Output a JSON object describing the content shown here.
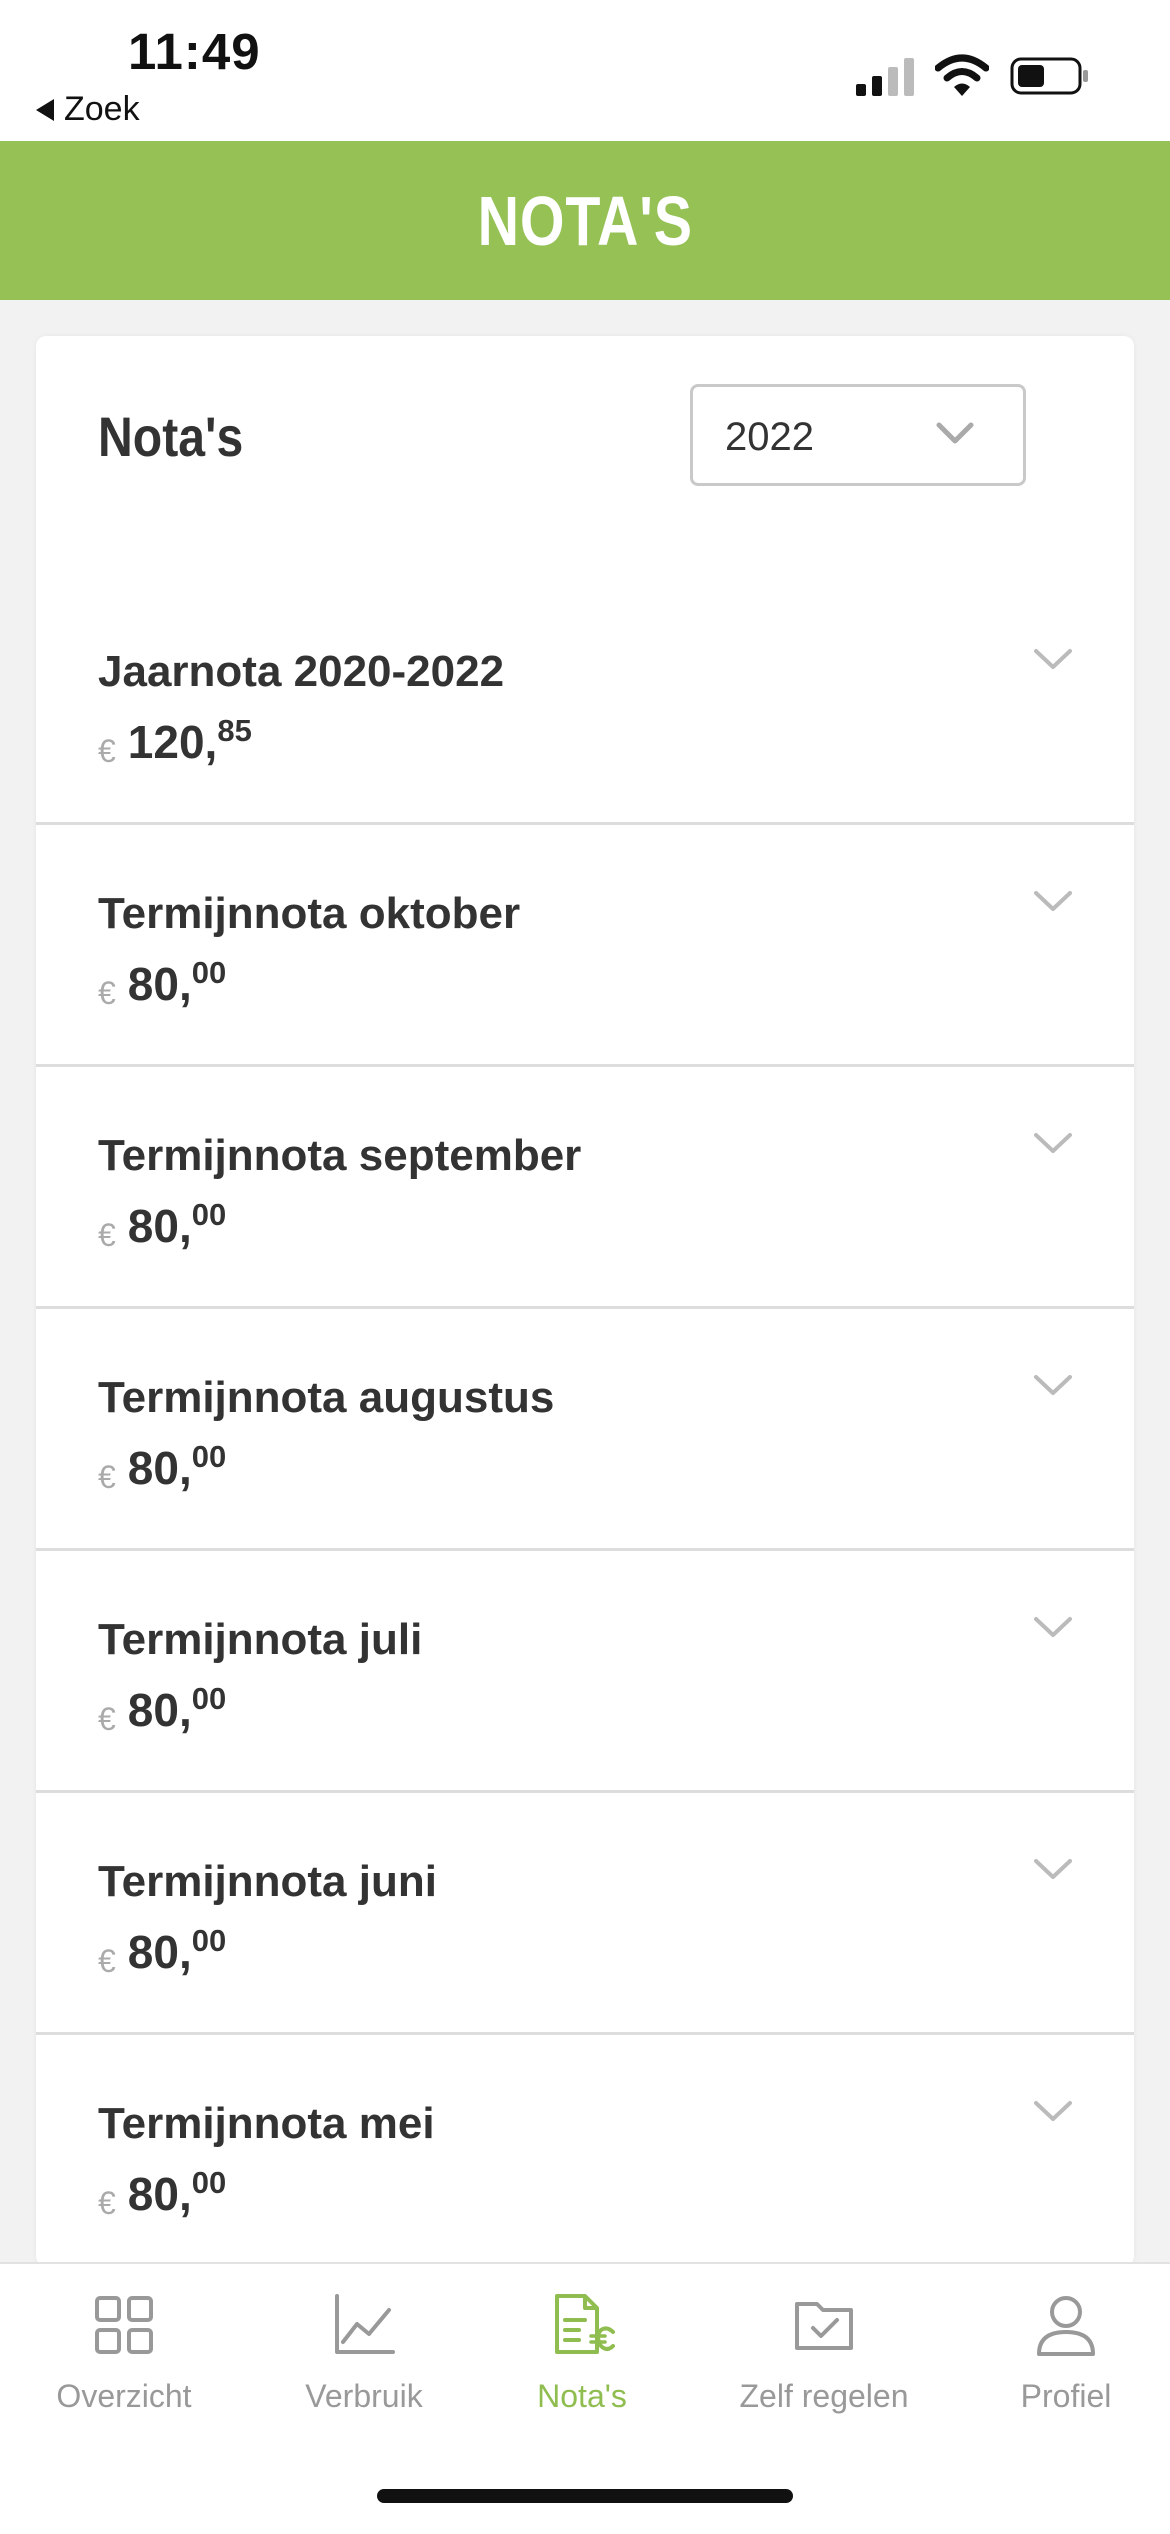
{
  "status_bar": {
    "time": "11:49",
    "back_label": "Zoek"
  },
  "header": {
    "title": "NOTA'S",
    "color": "#95c155"
  },
  "card": {
    "title": "Nota's",
    "year_select": {
      "value": "2022"
    }
  },
  "invoices": [
    {
      "title": "Jaarnota 2020-2022",
      "currency": "€",
      "amount_int": "120,",
      "amount_dec": "85"
    },
    {
      "title": "Termijnnota oktober",
      "currency": "€",
      "amount_int": "80,",
      "amount_dec": "00"
    },
    {
      "title": "Termijnnota september",
      "currency": "€",
      "amount_int": "80,",
      "amount_dec": "00"
    },
    {
      "title": "Termijnnota augustus",
      "currency": "€",
      "amount_int": "80,",
      "amount_dec": "00"
    },
    {
      "title": "Termijnnota juli",
      "currency": "€",
      "amount_int": "80,",
      "amount_dec": "00"
    },
    {
      "title": "Termijnnota juni",
      "currency": "€",
      "amount_int": "80,",
      "amount_dec": "00"
    },
    {
      "title": "Termijnnota mei",
      "currency": "€",
      "amount_int": "80,",
      "amount_dec": "00"
    }
  ],
  "bottom_nav": [
    {
      "label": "Overzicht",
      "icon": "grid-icon",
      "active": false
    },
    {
      "label": "Verbruik",
      "icon": "chart-icon",
      "active": false
    },
    {
      "label": "Nota's",
      "icon": "invoice-icon",
      "active": true
    },
    {
      "label": "Zelf regelen",
      "icon": "folder-check-icon",
      "active": false
    },
    {
      "label": "Profiel",
      "icon": "user-icon",
      "active": false
    }
  ],
  "colors": {
    "accent": "#95c155",
    "active_nav": "#8fbd4f",
    "inactive_nav": "#999999"
  }
}
